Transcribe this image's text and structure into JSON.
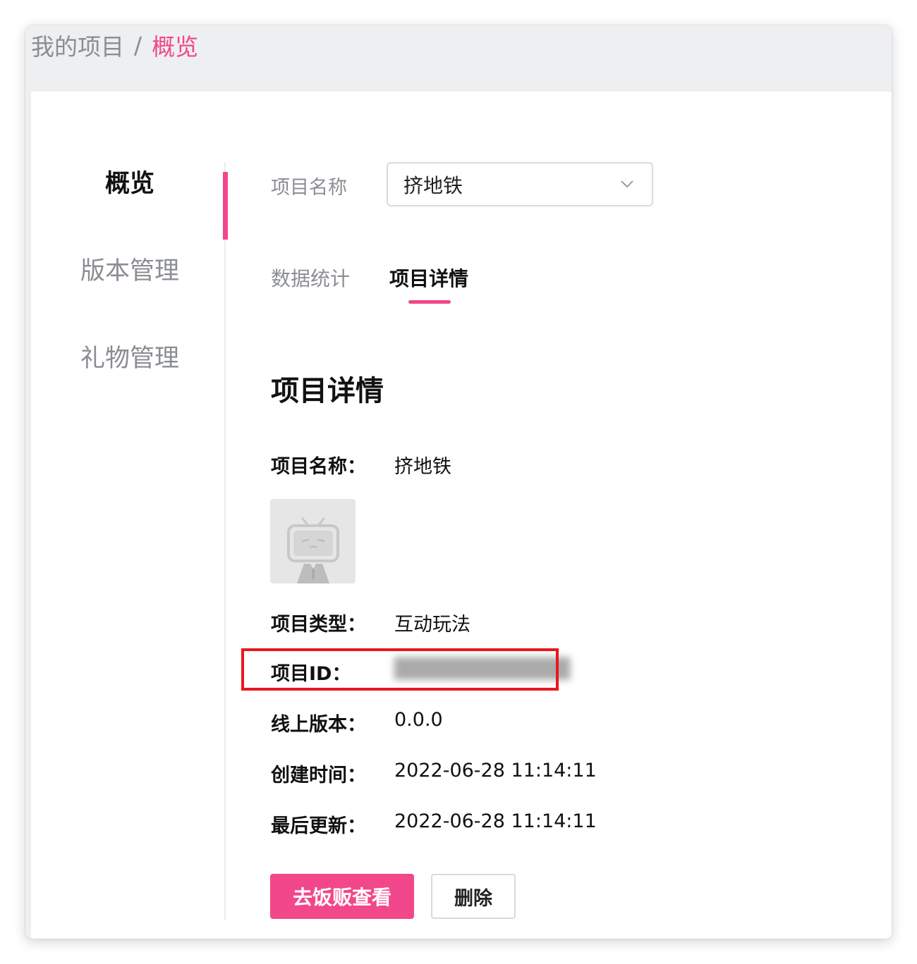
{
  "breadcrumb": {
    "parent": "我的项目",
    "separator": "/",
    "current": "概览"
  },
  "sidebar": {
    "items": [
      {
        "label": "概览",
        "active": true
      },
      {
        "label": "版本管理",
        "active": false
      },
      {
        "label": "礼物管理",
        "active": false
      }
    ]
  },
  "selector": {
    "label": "项目名称",
    "value": "挤地铁",
    "icon": "chevron-down-icon"
  },
  "tabs": [
    {
      "label": "数据统计",
      "active": false
    },
    {
      "label": "项目详情",
      "active": true
    }
  ],
  "details": {
    "title": "项目详情",
    "name_label": "项目名称：",
    "name_value": "挤地铁",
    "cover_icon": "bilibili-tv-placeholder-icon",
    "type_label": "项目类型：",
    "type_value": "互动玩法",
    "id_label": "项目ID：",
    "id_value": "████████████",
    "version_label": "线上版本：",
    "version_value": "0.0.0",
    "created_label": "创建时间：",
    "created_value": "2022-06-28 11:14:11",
    "updated_label": "最后更新：",
    "updated_value": "2022-06-28 11:14:11"
  },
  "actions": {
    "view_label": "去饭贩查看",
    "delete_label": "删除"
  },
  "colors": {
    "accent": "#f2478a",
    "highlight": "#e8171f",
    "muted": "#8a8d93"
  }
}
